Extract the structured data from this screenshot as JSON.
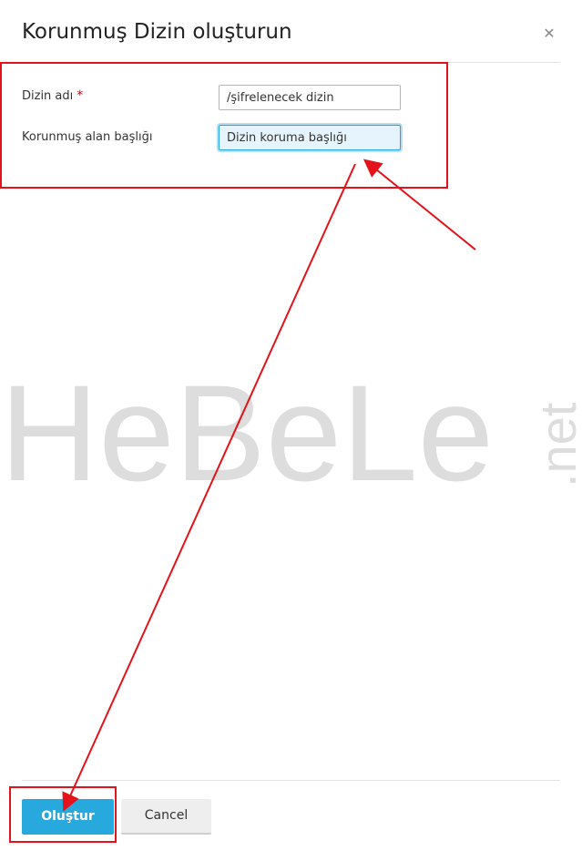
{
  "dialog": {
    "title": "Korunmuş Dizin oluşturun",
    "close_icon": "close-icon"
  },
  "form": {
    "directory_name": {
      "label": "Dizin adı",
      "required_mark": "*",
      "value": "/şifrelenecek dizin"
    },
    "protected_area_title": {
      "label": "Korunmuş alan başlığı",
      "value": "Dizin koruma başlığı"
    }
  },
  "buttons": {
    "create_label": "Oluştur",
    "cancel_label": "Cancel"
  },
  "watermark": {
    "main": "HeBeLe",
    "suffix": ".net"
  },
  "colors": {
    "primary": "#28a9de",
    "annotation": "#e3121b",
    "required": "#d0021b",
    "focus_background": "#e6f5fd"
  }
}
